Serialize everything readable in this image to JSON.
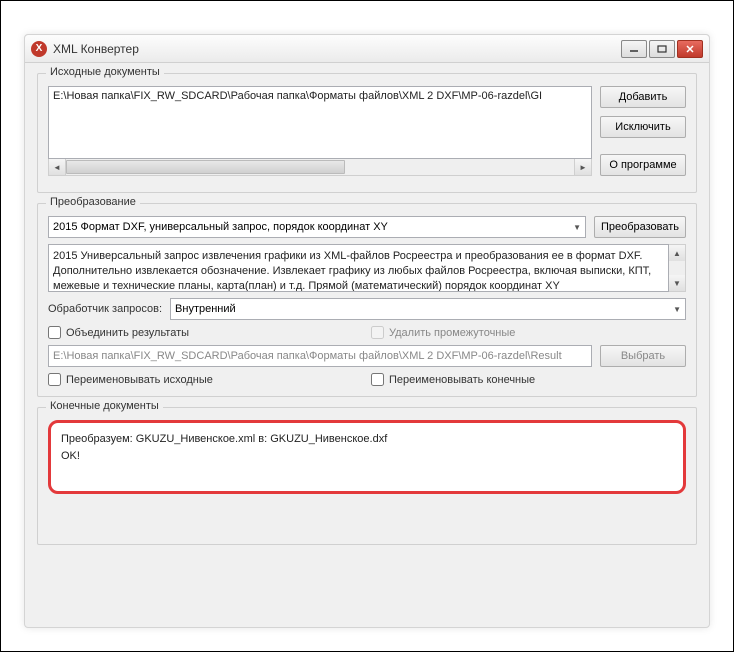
{
  "window": {
    "title": "XML Конвертер",
    "icon_letter": "X"
  },
  "source": {
    "group_title": "Исходные документы",
    "file_entry": "E:\\Новая папка\\FIX_RW_SDCARD\\Рабочая папка\\Форматы файлов\\XML 2 DXF\\MP-06-razdel\\GI",
    "add_label": "Добавить",
    "remove_label": "Исключить",
    "about_label": "О программе"
  },
  "transform": {
    "group_title": "Преобразование",
    "format_selected": "2015 Формат DXF, универсальный запрос, порядок координат XY",
    "convert_label": "Преобразовать",
    "description": "2015 Универсальный запрос извлечения графики из XML-файлов Росреестра и преобразования ее в формат DXF. Дополнительно извлекается обозначение. Извлекает графику из любых файлов Росреестра, включая выписки, КПТ, межевые и технические планы, карта(план) и т.д. Прямой (математический) порядок координат XY",
    "handler_label": "Обработчик запросов:",
    "handler_selected": "Внутренний",
    "merge_label": "Объединить результаты",
    "delete_temp_label": "Удалить промежуточные",
    "result_path": "E:\\Новая папка\\FIX_RW_SDCARD\\Рабочая папка\\Форматы файлов\\XML 2 DXF\\MP-06-razdel\\Result",
    "choose_label": "Выбрать",
    "rename_src_label": "Переименовывать исходные",
    "rename_dst_label": "Переименовывать конечные"
  },
  "result": {
    "group_title": "Конечные документы",
    "line1": "Преобразуем: GKUZU_Нивенское.xml в: GKUZU_Нивенское.dxf",
    "line2": "OK!"
  }
}
